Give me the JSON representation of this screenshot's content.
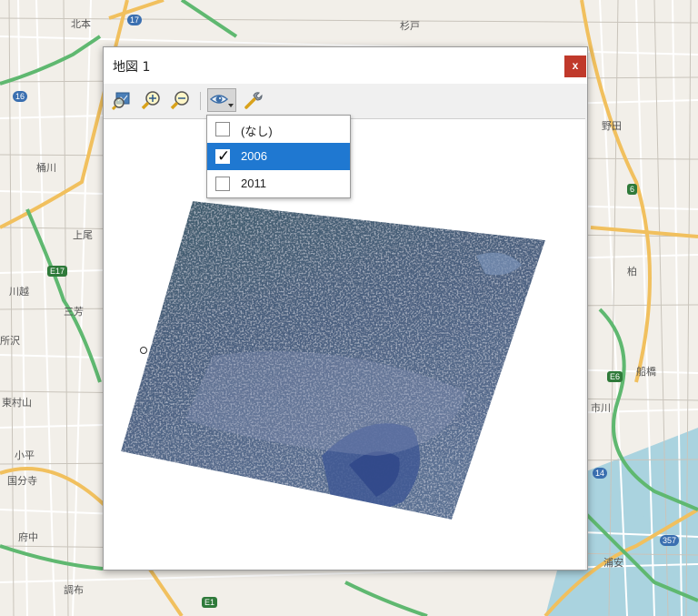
{
  "background_map": {
    "labels": [
      "北本",
      "桶川",
      "上尾",
      "川越",
      "三芳",
      "所沢",
      "東村山",
      "小平",
      "国分寺",
      "府中",
      "調布",
      "野田",
      "柏",
      "市川",
      "船橋",
      "浦安",
      "杉戸"
    ],
    "route_shields": [
      "17",
      "E17",
      "E1",
      "14",
      "357",
      "6",
      "E6",
      "16"
    ],
    "colors": {
      "land": "#f2efe9",
      "major_road": "#f1c05e",
      "highway": "#5fb870",
      "water": "#aad3df",
      "minor_road": "#ffffff"
    }
  },
  "window": {
    "title": "地図 1",
    "close_label": "x"
  },
  "toolbar": {
    "buttons": [
      {
        "name": "zoom-full-extent",
        "icon": "zoom-extent-icon"
      },
      {
        "name": "zoom-in",
        "icon": "zoom-in-icon"
      },
      {
        "name": "zoom-out",
        "icon": "zoom-out-icon"
      },
      {
        "name": "layer-visibility",
        "icon": "eye-dropdown-icon",
        "active": true
      },
      {
        "name": "settings",
        "icon": "wrench-icon"
      }
    ]
  },
  "layer_menu": {
    "items": [
      {
        "label": "(なし)",
        "checked": false
      },
      {
        "label": "2006",
        "checked": true
      },
      {
        "label": "2011",
        "checked": false
      }
    ],
    "check_glyph": "✓"
  },
  "canvas": {
    "layer_shown": "2006",
    "image": "satellite-imagery"
  }
}
